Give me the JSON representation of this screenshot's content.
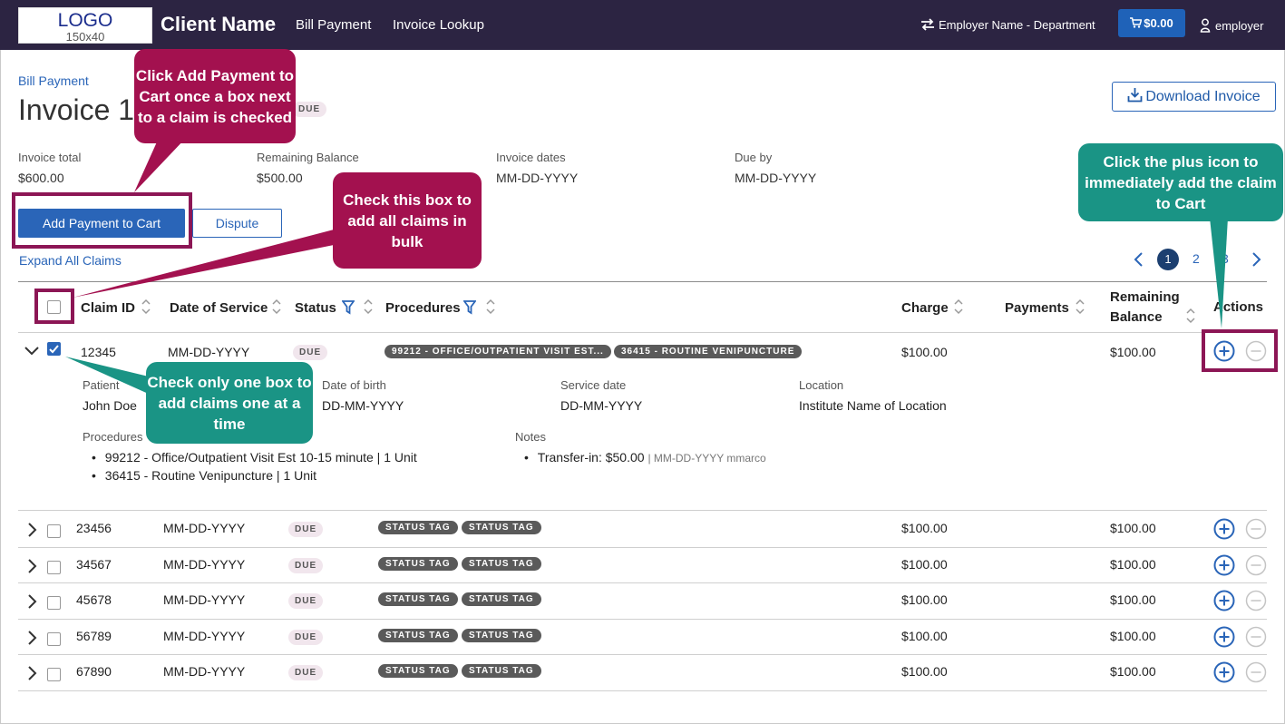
{
  "nav": {
    "logo_line1": "LOGO",
    "logo_line2": "150x40",
    "client_name": "Client Name",
    "links": [
      "Bill Payment",
      "Invoice Lookup"
    ],
    "employer": "Employer Name - Department",
    "cart_total": "$0.00",
    "user": "employer"
  },
  "header": {
    "breadcrumb": "Bill Payment",
    "title": "Invoice 1",
    "status_badge": "DUE",
    "download_button": "Download Invoice"
  },
  "summary": [
    {
      "label": "Invoice total",
      "value": "$600.00"
    },
    {
      "label": "Remaining Balance",
      "value": "$500.00"
    },
    {
      "label": "Invoice dates",
      "value": "MM-DD-YYYY"
    },
    {
      "label": "Due by",
      "value": "MM-DD-YYYY"
    }
  ],
  "actions": {
    "add_payment": "Add Payment to Cart",
    "dispute": "Dispute",
    "expand_all": "Expand All Claims"
  },
  "pagination": {
    "pages": [
      "1",
      "2",
      "3"
    ],
    "current": "1"
  },
  "table": {
    "headers": {
      "claim_id": "Claim ID",
      "date_of_service": "Date of Service",
      "status": "Status",
      "procedures": "Procedures",
      "charge": "Charge",
      "payments": "Payments",
      "remaining_line1": "Remaining",
      "remaining_line2": "Balance",
      "actions": "Actions"
    },
    "expanded_row": {
      "claim_id": "12345",
      "date": "MM-DD-YYYY",
      "status": "DUE",
      "tags": [
        "99212 - OFFICE/OUTPATIENT VISIT EST...",
        "36415 - ROUTINE VENIPUNCTURE"
      ],
      "charge": "$100.00",
      "remaining": "$100.00",
      "details": {
        "patient_label": "Patient",
        "patient_value": "John Doe",
        "dob_label": "Date of birth",
        "dob_value": "DD-MM-YYYY",
        "service_label": "Service date",
        "service_value": "DD-MM-YYYY",
        "location_label": "Location",
        "location_value": "Institute Name of Location",
        "procedures_label": "Procedures",
        "procedures": [
          "99212 - Office/Outpatient Visit Est 10-15 minute | 1 Unit",
          "36415 - Routine Venipuncture | 1 Unit"
        ],
        "notes_label": "Notes",
        "note_text": "Transfer-in: $50.00",
        "note_meta": "| MM-DD-YYYY mmarco"
      }
    },
    "rows": [
      {
        "claim_id": "23456",
        "date": "MM-DD-YYYY",
        "status": "DUE",
        "tags": [
          "STATUS TAG",
          "STATUS TAG"
        ],
        "charge": "$100.00",
        "remaining": "$100.00"
      },
      {
        "claim_id": "34567",
        "date": "MM-DD-YYYY",
        "status": "DUE",
        "tags": [
          "STATUS TAG",
          "STATUS TAG"
        ],
        "charge": "$100.00",
        "remaining": "$100.00"
      },
      {
        "claim_id": "45678",
        "date": "MM-DD-YYYY",
        "status": "DUE",
        "tags": [
          "STATUS TAG",
          "STATUS TAG"
        ],
        "charge": "$100.00",
        "remaining": "$100.00"
      },
      {
        "claim_id": "56789",
        "date": "MM-DD-YYYY",
        "status": "DUE",
        "tags": [
          "STATUS TAG",
          "STATUS TAG"
        ],
        "charge": "$100.00",
        "remaining": "$100.00"
      },
      {
        "claim_id": "67890",
        "date": "MM-DD-YYYY",
        "status": "DUE",
        "tags": [
          "STATUS TAG",
          "STATUS TAG"
        ],
        "charge": "$100.00",
        "remaining": "$100.00"
      }
    ]
  },
  "annotations": {
    "add_payment_note": "Click Add Payment to Cart once a box next to a claim is checked",
    "bulk_note": "Check this box to add all claims in bulk",
    "plus_note": "Click the plus icon to immediately add the claim to Cart",
    "single_note": "Check only one box to add claims one at a time"
  },
  "colors": {
    "nav_bg": "#2c2442",
    "primary": "#2a65b8",
    "annotation_red": "#a3114f",
    "annotation_teal": "#1a9485",
    "highlight_border": "#8c1655"
  }
}
